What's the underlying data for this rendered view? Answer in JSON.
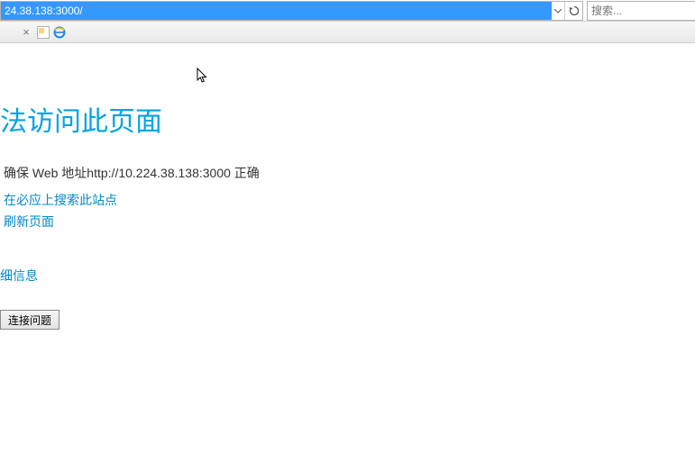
{
  "toolbar": {
    "address_value": "24.38.138:3000/",
    "search_placeholder": "搜索..."
  },
  "error_page": {
    "title": "法访问此页面",
    "message": "确保 Web 地址http://10.224.38.138:3000 正确",
    "link_bing_search": "在必应上搜索此站点",
    "link_refresh": "刷新页面",
    "details_label": "细信息",
    "fix_button_label": "连接问题"
  }
}
